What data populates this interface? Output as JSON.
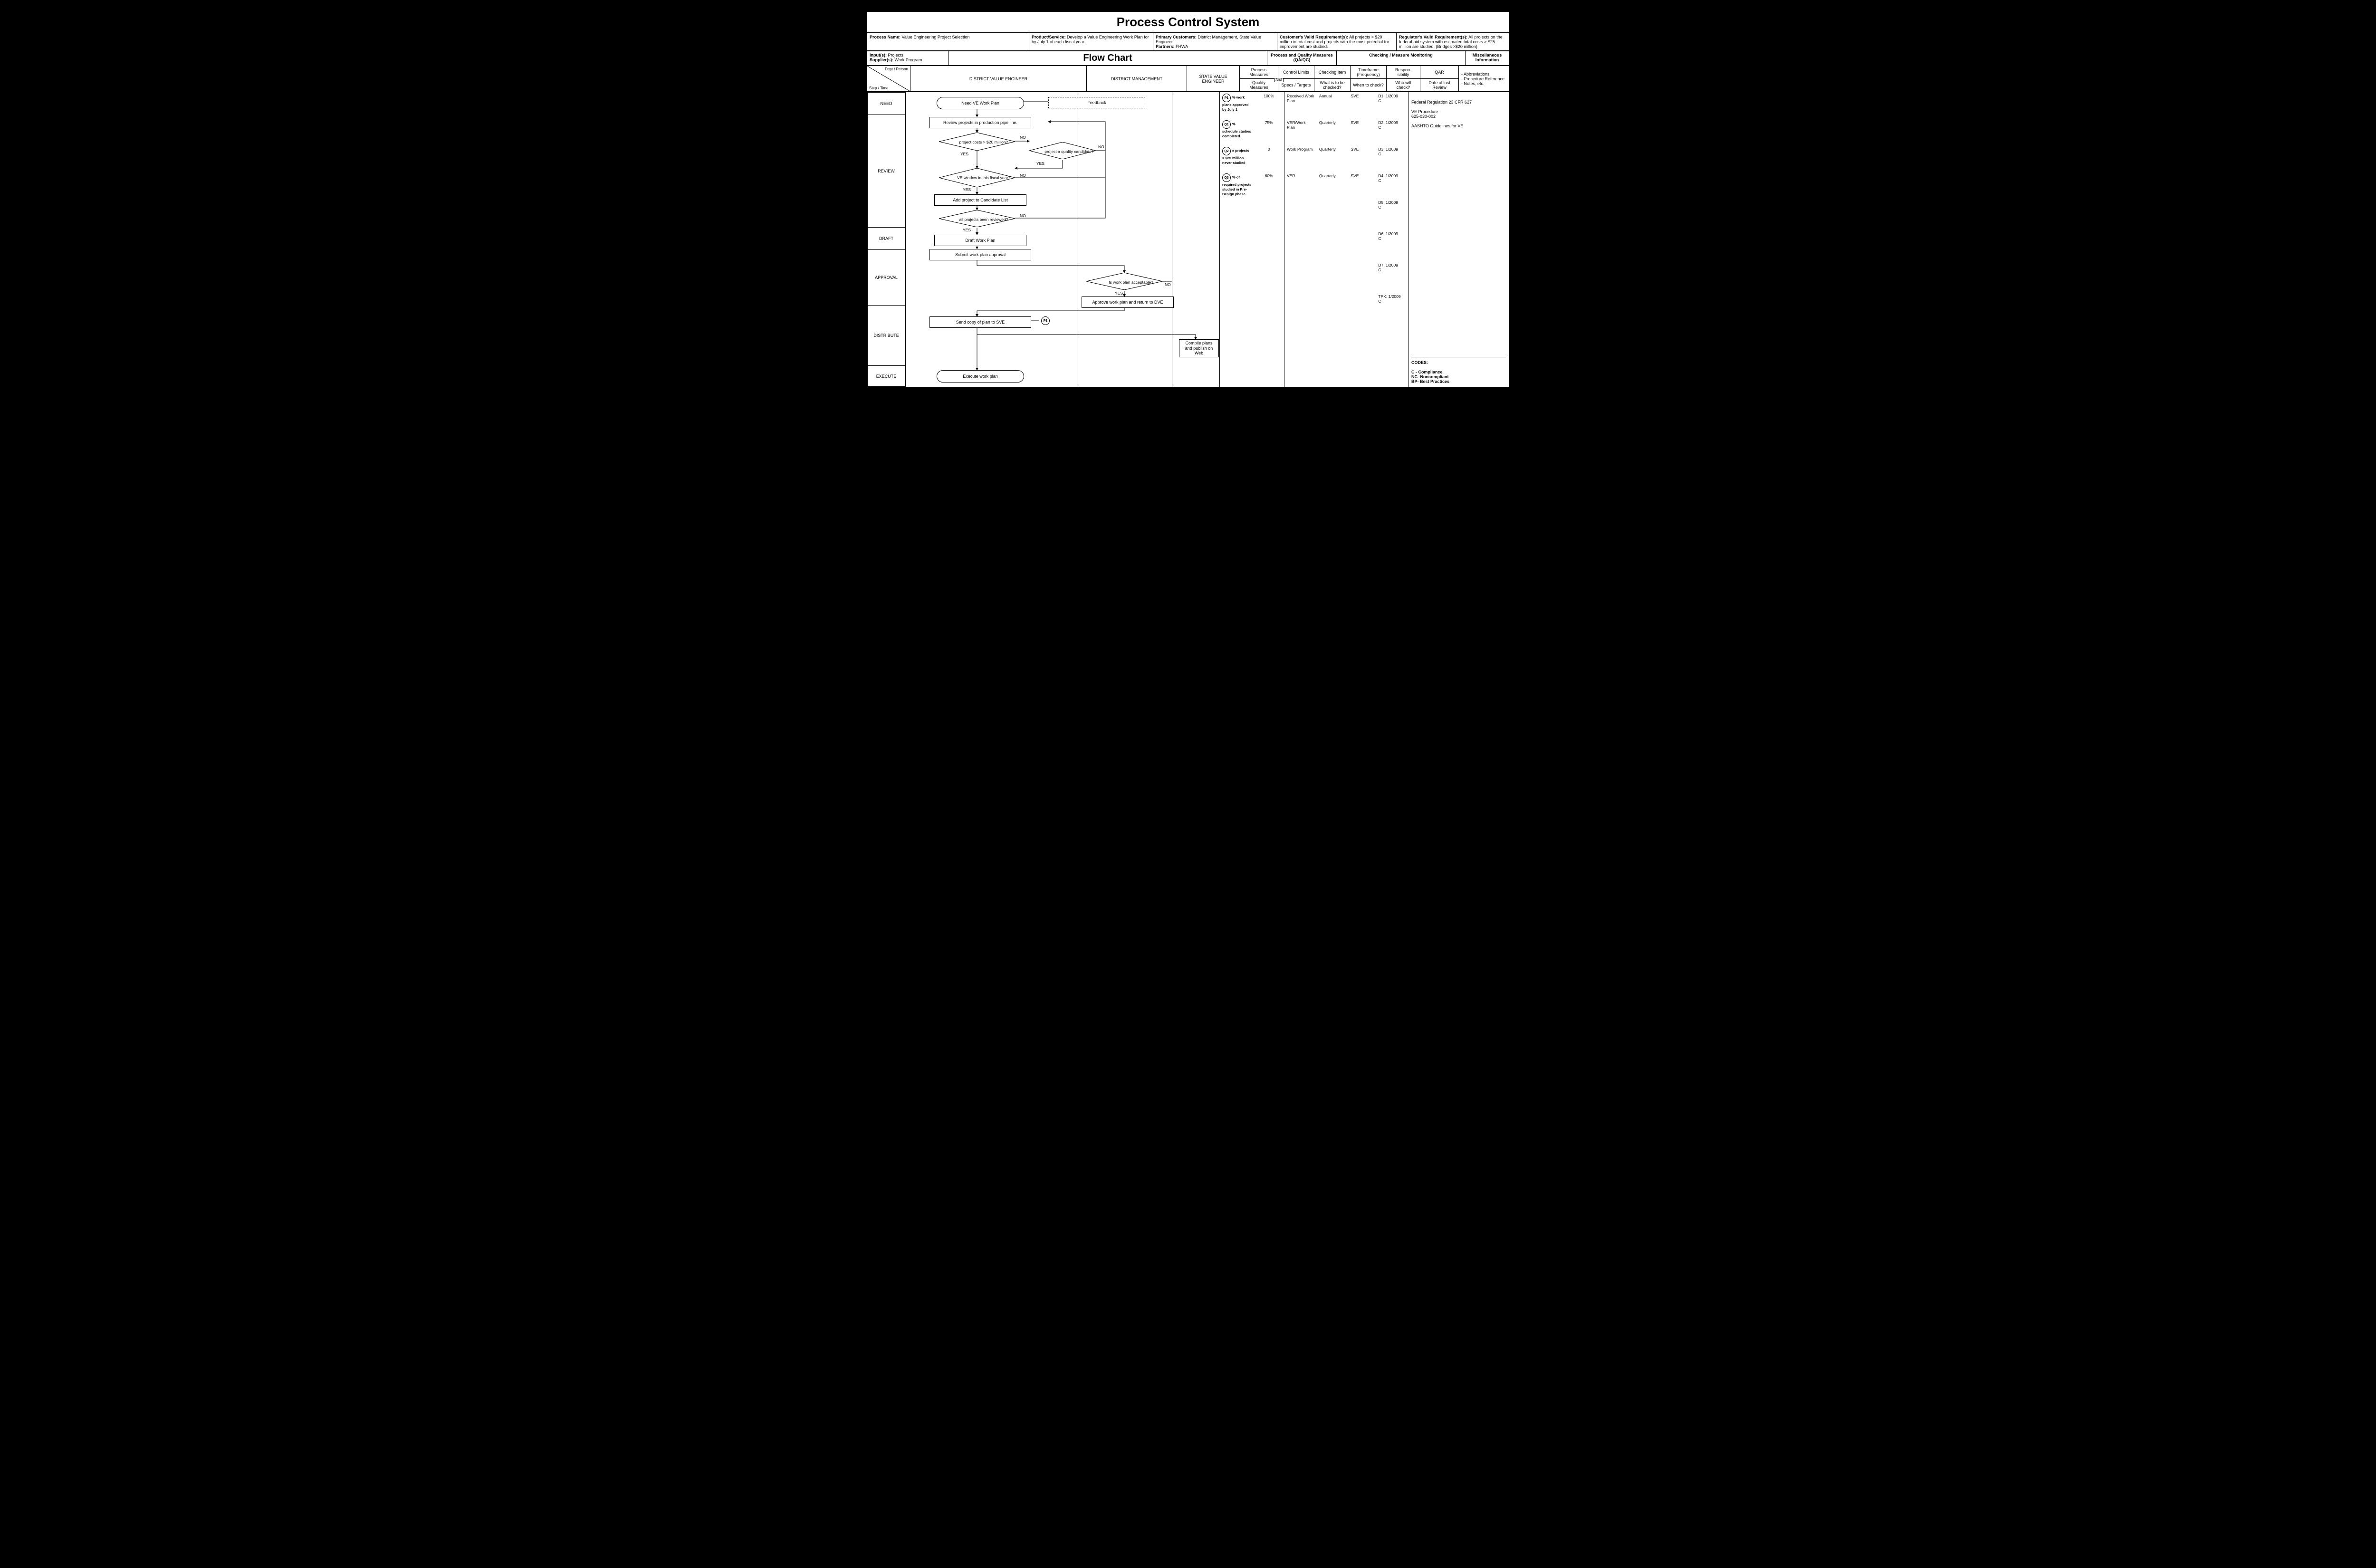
{
  "title": "Process Control System",
  "meta": {
    "process_name_label": "Process Name:",
    "process_name": " Value Engineering Project Selection",
    "product_label": "Product/Service:",
    "product": "  Develop a Value Engineering Work Plan for by July 1 of each fiscal year.",
    "primary_customers_label": "Primary Customers:",
    "primary_customers": "   District Management, State Value Engineer",
    "partners_label": "Partners:",
    "partners": " FHWA",
    "cust_req_label": "Customer's Valid Requirement(s):",
    "cust_req": " All projects > $20 million in total cost and projects with the most potential for  improvement are studied.",
    "reg_req_label": "Regulator's Valid Requirement(s):",
    "reg_req": " All projects on the federal-aid system with estimated total costs  > $25 million are studied. (Bridges >$20 million)",
    "inputs_label": "Input(s):",
    "inputs": " Projects",
    "suppliers_label": "Supplier(s):",
    "suppliers": " Work Program",
    "flowchart": "Flow Chart",
    "pq_header": "Process and Quality Measures (QA/QC)",
    "cm_header": "Checking / Measure Monitoring",
    "misc_header": "Miscellaneous Information",
    "dept_person": "Dept / Person",
    "step_time": "Step / Time",
    "lanes": {
      "a": "DISTRICT VALUE ENGINEER",
      "b": "DISTRICT MANAGEMENT",
      "c": "STATE VALUE ENGINEER"
    },
    "pm": "Process Measures",
    "cl": "Control Limits",
    "qm": "Quality Measures",
    "st": "Specs / Targets",
    "and": "And",
    "ci": "Checking Item",
    "tf": "Timeframe (Frequency)",
    "rs": "Respon-\nsibility",
    "qar": "QAR",
    "wtc": "What is to be checked?",
    "wnc": "When to check?",
    "wwc": "Who will check?",
    "dlr": "Date of last Review",
    "misc_items": "-   Abbreviations\n-   Procedure Reference\n-   Notes, etc."
  },
  "steps": [
    "NEED",
    "REVIEW",
    "DRAFT",
    "APPROVAL",
    "DISTRIBUTE",
    "EXECUTE"
  ],
  "fc": {
    "need": "Need VE Work Plan",
    "feedback": "Feedback",
    "review_proj": "Review projects in production pipe line.",
    "d1": "project costs > $20 million?",
    "d2": "project a quality candidate?",
    "d3": "VE window in this fiscal year?",
    "add": "Add project to Candidate List",
    "d4": "all projects been reviewed?",
    "draft": "Draft Work Plan",
    "submit": "Submit work plan approval",
    "d5": "Is work plan acceptable?",
    "approve": "Approve work plan and return to DVE",
    "send": "Send copy of plan to SVE",
    "p1": "P1",
    "compile": "Compile plans and publish on Web",
    "exec": "Execute work plan",
    "yes": "YES",
    "no": "NO"
  },
  "measures": [
    {
      "id": "P1",
      "m": "% work plans approved by July 1",
      "lim": "100%",
      "ci": "Received Work Plan",
      "tf": "Annual",
      "rs": "SVE",
      "qar": "D1: 1/2009\nC"
    },
    {
      "id": "Q1",
      "m": "% schedule studies completed",
      "lim": "75%",
      "ci": "VER/Work Plan",
      "tf": "Quarterly",
      "rs": "SVE",
      "qar": "D2: 1/2009\nC"
    },
    {
      "id": "Q2",
      "m": "# projects > $25 million never studied",
      "lim": "0",
      "ci": "Work Program",
      "tf": "Quarterly",
      "rs": "SVE",
      "qar": "D3: 1/2009\nC"
    },
    {
      "id": "Q3",
      "m": "% of required projects studied in Pre-Design phase",
      "lim": "60%",
      "ci": "VER",
      "tf": "Quarterly",
      "rs": "SVE",
      "qar": "D4: 1/2009\nC"
    }
  ],
  "extra_qar": [
    "D5: 1/2009\nC",
    "D6: 1/2009\nC",
    "D7: 1/2009\nC",
    "TPK: 1/2009\nC"
  ],
  "misc_text": "Federal Regulation 23 CFR 627\n\nVE Procedure\n625-030-002\n\nAASHTO Guidelines for VE",
  "codes": "CODES:\n\nC - Compliance\nNC- Noncompliant\nBP- Best Practices"
}
